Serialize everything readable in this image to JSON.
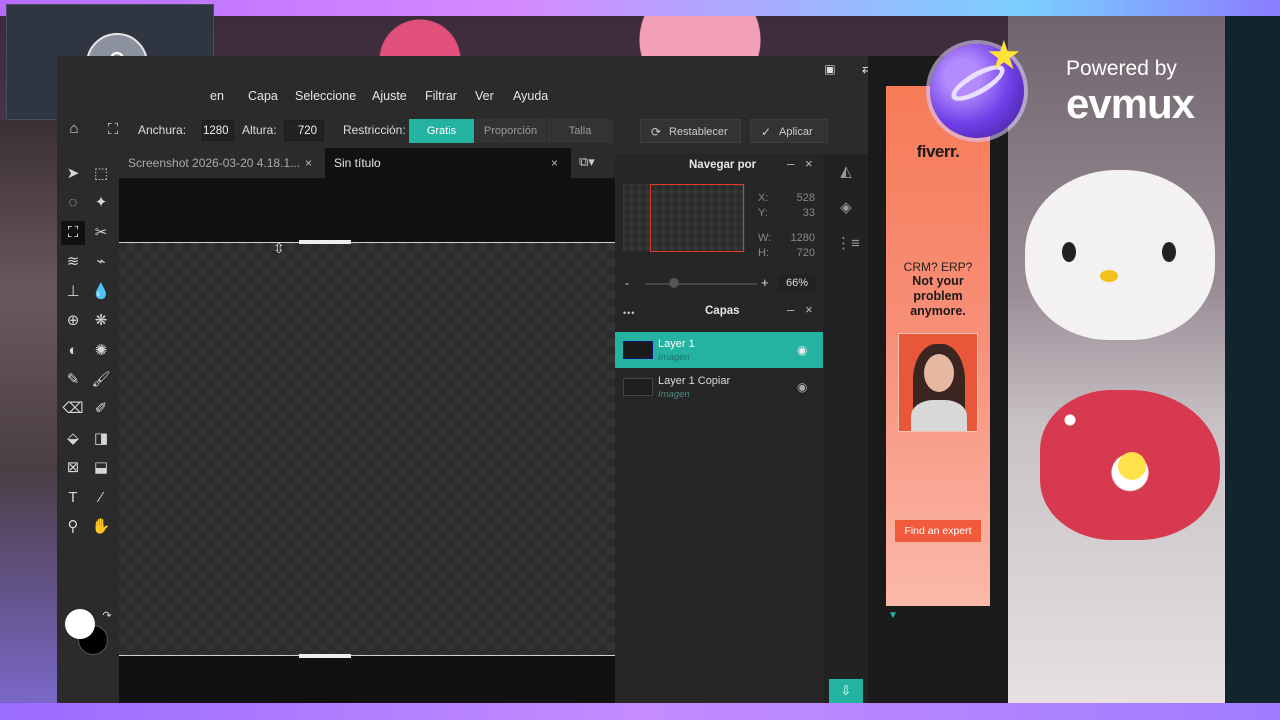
{
  "menu": {
    "items": [
      "Imagen",
      "Capa",
      "Seleccione",
      "Ajuste",
      "Filtrar",
      "Ver",
      "Ayuda"
    ],
    "first_partial": "en"
  },
  "options": {
    "width_label": "Anchura:",
    "width_value": "1280",
    "height_label": "Altura:",
    "height_value": "720",
    "restriction_label": "Restricción:",
    "modes": [
      "Gratis",
      "Proporción",
      "Talla"
    ],
    "active_mode": "Gratis",
    "reset_label": "Restablecer",
    "apply_label": "Aplicar"
  },
  "tabs": [
    {
      "label": "Screenshot 2026-03-20 4.18.1...",
      "close": "×"
    },
    {
      "label": "Sin título",
      "close": "×"
    }
  ],
  "navigator": {
    "title": "Navegar por",
    "x_label": "X:",
    "x_value": "528",
    "y_label": "Y:",
    "y_value": "33",
    "w_label": "W:",
    "w_value": "1280",
    "h_label": "H:",
    "h_value": "720",
    "zoom_minus": "-",
    "zoom_plus": "+",
    "zoom_value": "66%"
  },
  "layers": {
    "menu_dots": "•••",
    "title": "Capas",
    "items": [
      {
        "name": "Layer 1",
        "type": "Imagen",
        "active": true
      },
      {
        "name": "Layer 1 Copiar",
        "type": "Imagen",
        "active": false
      }
    ]
  },
  "ad": {
    "logo": "fiverr.",
    "question": "CRM? ERP?",
    "headline": "Not your problem anymore.",
    "cta": "Find an expert"
  },
  "watermark": {
    "powered_by": "Powered by",
    "brand": "evmux"
  },
  "colors": {
    "accent": "#23b3a0",
    "ad_bg": "#f77b57",
    "selection_border": "#e03a2a"
  }
}
